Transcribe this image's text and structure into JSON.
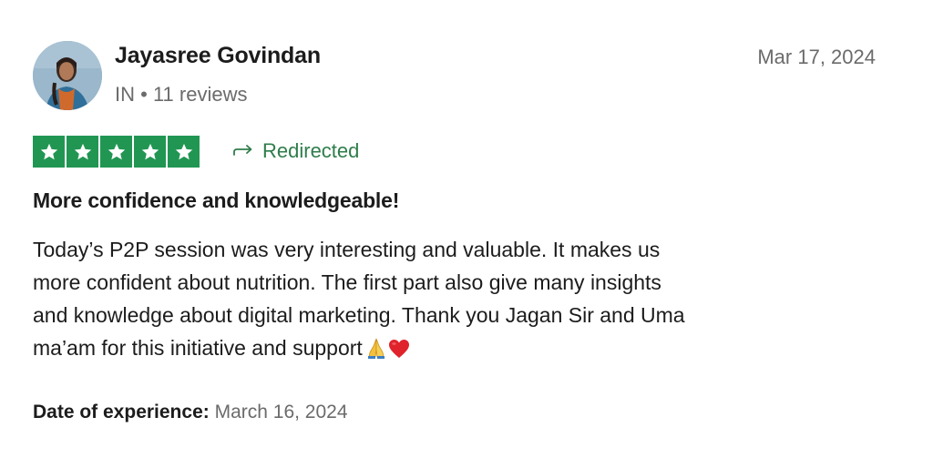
{
  "reviewer": {
    "name": "Jayasree Govindan",
    "country": "IN",
    "separator": "•",
    "reviews_count": "11 reviews"
  },
  "review": {
    "date": "Mar 17, 2024",
    "rating": 5,
    "rating_max": 5,
    "redirected_label": "Redirected",
    "title": "More confidence and knowledgeable!",
    "body_lines": [
      "Today’s P2P session was very interesting and valuable. It makes us",
      "more confident about nutrition. The first part also give many insights",
      "and knowledge about digital marketing. Thank you Jagan Sir and Uma",
      "ma’am for this initiative and support"
    ],
    "emojis": [
      "folded-hands-icon",
      "red-heart-icon"
    ],
    "experience_label": "Date of experience:",
    "experience_date": "March 16, 2024"
  },
  "colors": {
    "star_green": "#219653",
    "redirected_green": "#2e7d4a",
    "muted_text": "#6b6b6b",
    "primary_text": "#1c1c1c"
  },
  "icons": {
    "star": "star-icon",
    "redirect": "redirect-arrow-icon",
    "avatar": "avatar"
  }
}
